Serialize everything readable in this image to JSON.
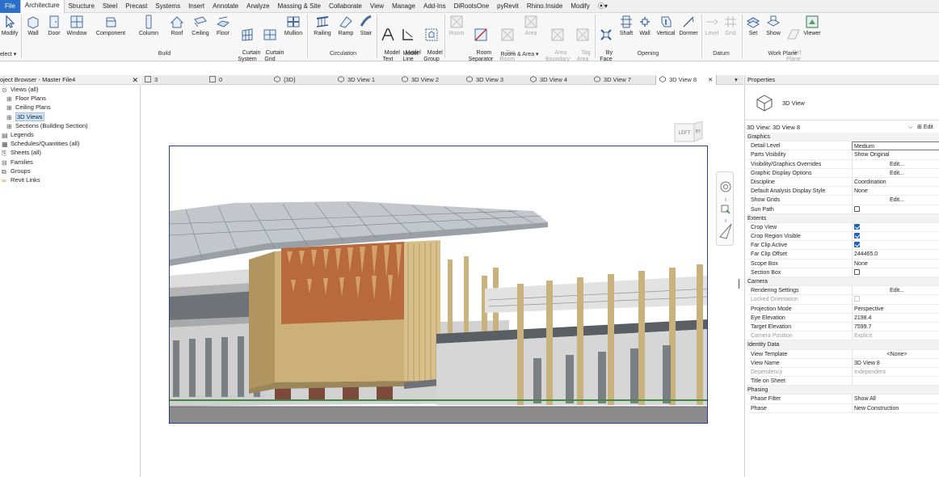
{
  "menu": {
    "tabs": [
      "File",
      "Architecture",
      "Structure",
      "Steel",
      "Precast",
      "Systems",
      "Insert",
      "Annotate",
      "Analyze",
      "Massing & Site",
      "Collaborate",
      "View",
      "Manage",
      "Add-Ins",
      "DiRootsOne",
      "pyRevit",
      "Rhino.Inside",
      "Modify"
    ],
    "active_tab": "Architecture"
  },
  "ribbon": {
    "select_label": "elect ▾",
    "tools": {
      "modify": "Modify",
      "wall": "Wall",
      "door": "Door",
      "window": "Window",
      "component": "Component",
      "column": "Column",
      "roof": "Roof",
      "ceiling": "Ceiling",
      "floor": "Floor",
      "curtain_system": "Curtain\nSystem",
      "curtain_grid": "Curtain\nGrid",
      "mullion": "Mullion",
      "railing": "Railing",
      "ramp": "Ramp",
      "stair": "Stair",
      "model_text": "Model\nText",
      "model_line": "Model\nLine",
      "model_group": "Model\nGroup",
      "room": "Room",
      "room_separator": "Room\nSeparator",
      "tag_room": "Tag\nRoom",
      "area": "Area",
      "area_boundary": "Area\nBoundary",
      "tag_area": "Tag\nArea",
      "by_face": "By\nFace",
      "shaft": "Shaft",
      "wall_opening": "Wall",
      "vertical": "Vertical",
      "dormer": "Dormer",
      "level": "Level",
      "grid": "Grid",
      "set": "Set",
      "show": "Show",
      "ref_plane": "Ref\nPlane",
      "viewer": "Viewer"
    },
    "groups": {
      "build": "Build",
      "circulation": "Circulation",
      "model": "Model",
      "room_area": "Room & Area ▾",
      "opening": "Opening",
      "datum": "Datum",
      "work_plane": "Work Plane"
    }
  },
  "project_browser": {
    "title": "oject Browser - Master File4",
    "items": [
      {
        "label": "Views (all)",
        "icon": "views-icon"
      },
      {
        "label": "Floor Plans",
        "icon": "expand-icon"
      },
      {
        "label": "Ceiling Plans",
        "icon": "expand-icon"
      },
      {
        "label": "3D Views",
        "icon": "expand-icon"
      },
      {
        "label": "Sections (Building Section)",
        "icon": "expand-icon"
      },
      {
        "label": "Legends",
        "icon": "legends-icon"
      },
      {
        "label": "Schedules/Quantities (all)",
        "icon": "schedules-icon"
      },
      {
        "label": "Sheets (all)",
        "icon": "sheets-icon"
      },
      {
        "label": "Families",
        "icon": "families-icon"
      },
      {
        "label": "Groups",
        "icon": "groups-icon"
      },
      {
        "label": "Revit Links",
        "icon": "links-icon"
      }
    ]
  },
  "view_tabs": [
    {
      "label": "3",
      "icon": "plan-view-icon"
    },
    {
      "label": "0",
      "icon": "plan-view-icon"
    },
    {
      "label": "{3D}",
      "icon": "3d-view-icon"
    },
    {
      "label": "3D View 1",
      "icon": "3d-view-icon"
    },
    {
      "label": "3D View 2",
      "icon": "3d-view-icon"
    },
    {
      "label": "3D View 3",
      "icon": "3d-view-icon"
    },
    {
      "label": "3D View 4",
      "icon": "3d-view-icon"
    },
    {
      "label": "3D View 7",
      "icon": "3d-view-icon"
    },
    {
      "label": "3D View 8",
      "icon": "3d-view-icon"
    }
  ],
  "viewcube": {
    "left": "LEFT",
    "right": "BY"
  },
  "properties": {
    "title": "Properties",
    "type_name": "3D View",
    "selector": "3D View: 3D View 8",
    "edit_type": "Edit",
    "rows": [
      {
        "kind": "group",
        "name": "Graphics"
      },
      {
        "name": "Detail Level",
        "value": "Medium",
        "style": "boxed"
      },
      {
        "name": "Parts Visibility",
        "value": "Show Original"
      },
      {
        "name": "Visibility/Graphics Overrides",
        "value": "Edit...",
        "style": "btn"
      },
      {
        "name": "Graphic Display Options",
        "value": "Edit...",
        "style": "btn"
      },
      {
        "name": "Discipline",
        "value": "Coordination"
      },
      {
        "name": "Default Analysis Display Style",
        "value": "None"
      },
      {
        "name": "Show Grids",
        "value": "Edit...",
        "style": "btn"
      },
      {
        "name": "Sun Path",
        "check": "off"
      },
      {
        "kind": "group",
        "name": "Extents"
      },
      {
        "name": "Crop View",
        "check": "on"
      },
      {
        "name": "Crop Region Visible",
        "check": "on"
      },
      {
        "name": "Far Clip Active",
        "check": "on"
      },
      {
        "name": "Far Clip Offset",
        "value": "244465.0"
      },
      {
        "name": "Scope Box",
        "value": "None"
      },
      {
        "name": "Section Box",
        "check": "off"
      },
      {
        "kind": "group",
        "name": "Camera"
      },
      {
        "name": "Rendering Settings",
        "value": "Edit...",
        "style": "btn"
      },
      {
        "name": "Locked Orientation",
        "check": "dis",
        "grey": true
      },
      {
        "name": "Projection Mode",
        "value": "Perspective"
      },
      {
        "name": "Eye Elevation",
        "value": "2198.4"
      },
      {
        "name": "Target Elevation",
        "value": "7599.7"
      },
      {
        "name": "Camera Position",
        "value": "Explicit",
        "grey": true
      },
      {
        "kind": "group",
        "name": "Identity Data"
      },
      {
        "name": "View Template",
        "value": "<None>",
        "style": "btn"
      },
      {
        "name": "View Name",
        "value": "3D View 8"
      },
      {
        "name": "Dependency",
        "value": "Independent",
        "grey": true
      },
      {
        "name": "Title on Sheet",
        "value": ""
      },
      {
        "kind": "group",
        "name": "Phasing"
      },
      {
        "name": "Phase Filter",
        "value": "Show All"
      },
      {
        "name": "Phase",
        "value": "New Construction"
      }
    ]
  },
  "colors": {
    "accent": "#2a6fc9",
    "crop_border": "#2c3d8f",
    "check": "#1e63c6"
  }
}
